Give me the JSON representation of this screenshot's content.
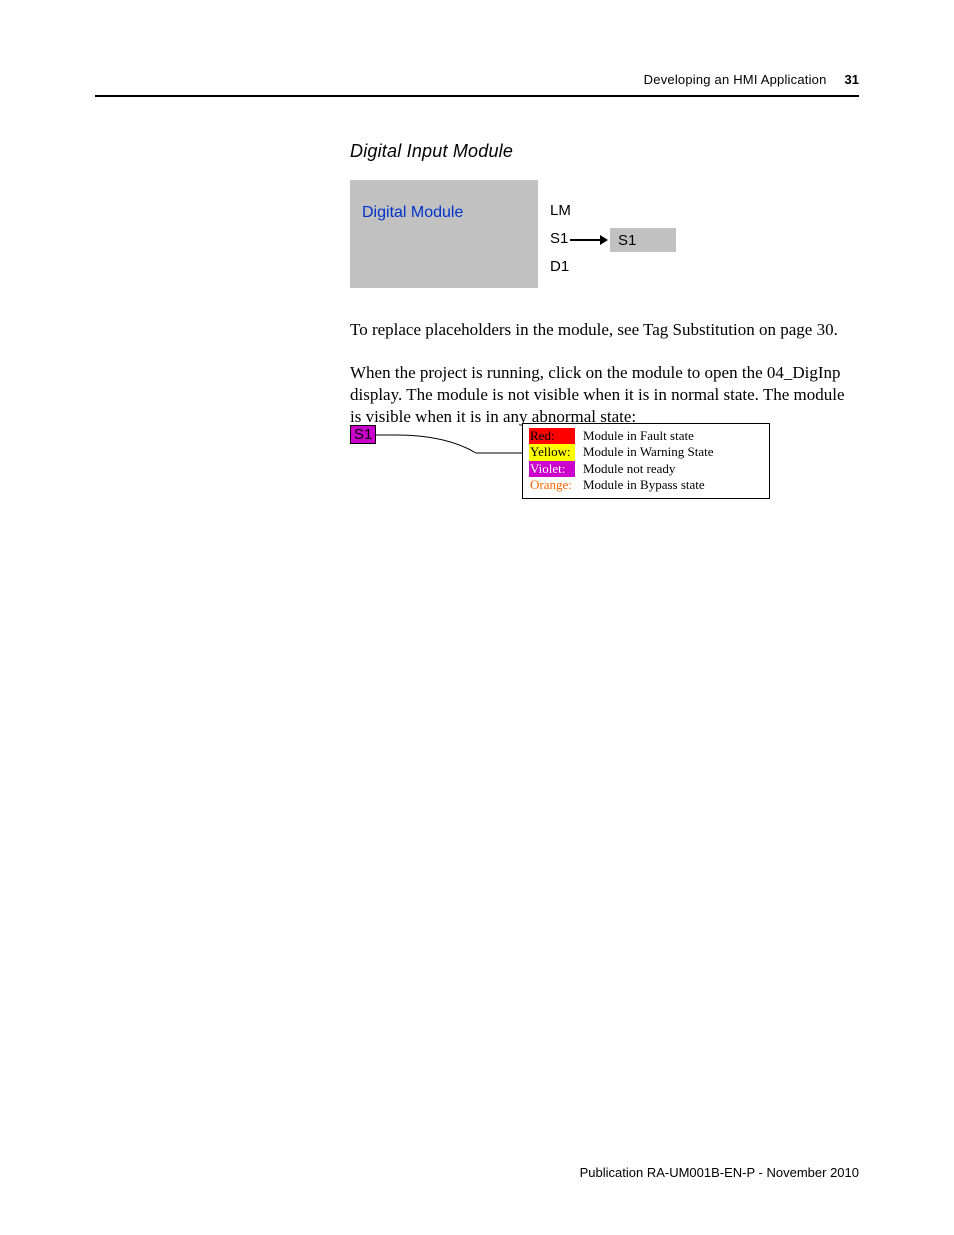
{
  "header": {
    "title": "Developing an HMI Application",
    "pageno": "31"
  },
  "section_title": "Digital Input Module",
  "fig1": {
    "box_left_label": "Digital Module",
    "lm": "LM",
    "s1": "S1",
    "d1": "D1",
    "box_right_label": "S1"
  },
  "para1": "To replace placeholders in the module, see Tag Substitution on page 30.",
  "para2": "When the project is running, click on the module to open the 04_DigInp display. The module is not visible when it is in normal state. The module is visible when it is in any abnormal state:",
  "fig2": {
    "badge": "S1",
    "legend": [
      {
        "tag": "Red:",
        "cls": "tag-red",
        "desc": "Module in Fault state"
      },
      {
        "tag": "Yellow:",
        "cls": "tag-yellow",
        "desc": "Module in Warning State"
      },
      {
        "tag": "Violet:",
        "cls": "tag-violet",
        "desc": "Module not ready"
      },
      {
        "tag": "Orange:",
        "cls": "tag-orange",
        "desc": "Module in Bypass state"
      }
    ]
  },
  "footer": "Publication RA-UM001B-EN-P - November 2010"
}
